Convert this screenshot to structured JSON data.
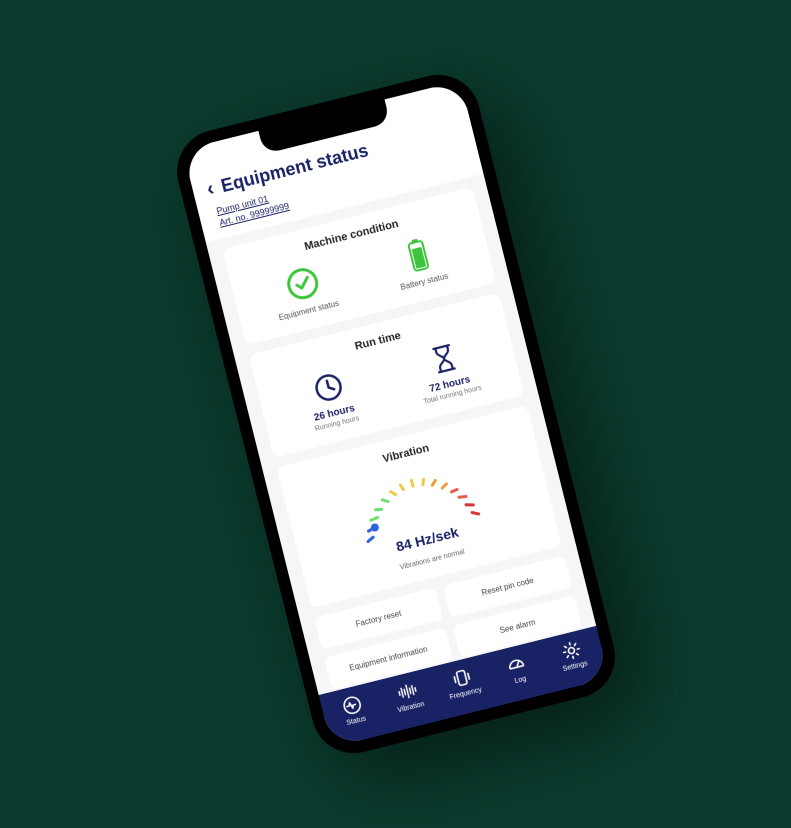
{
  "header": {
    "title": "Equipment status",
    "unit_link": "Pump unit 01",
    "artno_link": "Art. no. 99999999"
  },
  "machine_condition": {
    "title": "Machine condition",
    "equipment_status_label": "Equipment status",
    "battery_status_label": "Battery status"
  },
  "run_time": {
    "title": "Run time",
    "running_hours_value": "26 hours",
    "running_hours_label": "Running hours",
    "total_hours_value": "72 hours",
    "total_hours_label": "Total running hours"
  },
  "vibration": {
    "title": "Vibration",
    "value": "84 Hz/sek",
    "message": "Vibrations are normal"
  },
  "buttons": {
    "factory_reset": "Factory reset",
    "reset_pin": "Reset pin code",
    "equipment_info": "Equipment information",
    "see_alarm": "See alarm"
  },
  "nav": {
    "status": "Status",
    "vibration": "Vibration",
    "frequency": "Frequency",
    "log": "Log",
    "settings": "Settings"
  }
}
